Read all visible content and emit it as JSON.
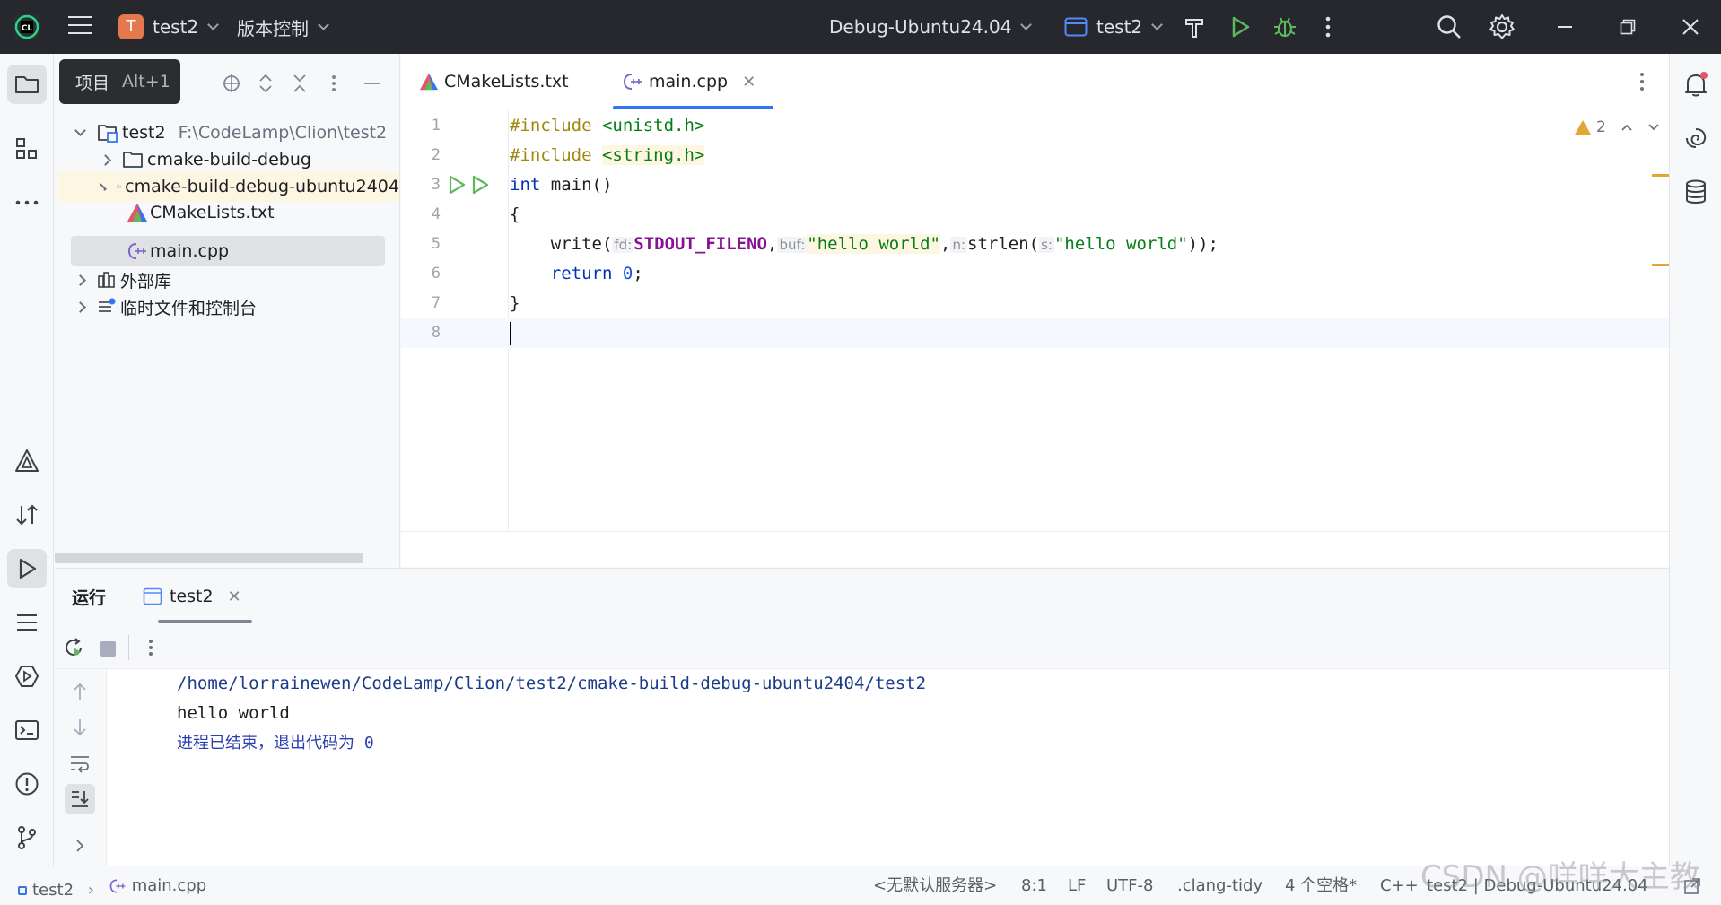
{
  "titlebar": {
    "project_letter": "T",
    "project_name": "test2",
    "vcs_label": "版本控制",
    "run_config": "Debug-Ubuntu24.04",
    "target": "test2"
  },
  "tooltip": {
    "label": "项目",
    "shortcut": "Alt+1"
  },
  "project_tree": {
    "root_name": "test2",
    "root_path": "F:\\CodeLamp\\Clion\\test2",
    "items": [
      {
        "label": "cmake-build-debug"
      },
      {
        "label": "cmake-build-debug-ubuntu2404"
      },
      {
        "label": "CMakeLists.txt"
      },
      {
        "label": "main.cpp"
      }
    ],
    "external_libs": "外部库",
    "scratches": "临时文件和控制台"
  },
  "editor": {
    "tabs": [
      {
        "label": "CMakeLists.txt"
      },
      {
        "label": "main.cpp"
      }
    ],
    "warning_count": "2",
    "line_numbers": [
      "1",
      "2",
      "3",
      "4",
      "5",
      "6",
      "7",
      "8"
    ],
    "code": {
      "l1_directive": "#include",
      "l1_header": "<unistd.h>",
      "l2_directive": "#include",
      "l2_header": "<string.h>",
      "l3_type": "int",
      "l3_rest": " main()",
      "l4": "{",
      "l5_call": "write(",
      "l5_hint_fd": "fd:",
      "l5_arg1": "STDOUT_FILENO",
      "l5_comma1": ",",
      "l5_hint_buf": "buf:",
      "l5_arg2": "\"hello world\"",
      "l5_comma2": ",",
      "l5_hint_n": "n:",
      "l5_call2": "strlen(",
      "l5_hint_s": "s:",
      "l5_arg3": "\"hello world\"",
      "l5_end": "));",
      "l6_kw": "return",
      "l6_num": "0",
      "l6_end": ";",
      "l7": "}"
    }
  },
  "run_panel": {
    "title": "运行",
    "tab_label": "test2",
    "console_lines": [
      "/home/lorrainewen/CodeLamp/Clion/test2/cmake-build-debug-ubuntu2404/test2",
      "hello world",
      "进程已结束，退出代码为 0"
    ]
  },
  "statusbar": {
    "crumb_project": "test2",
    "crumb_file": "main.cpp",
    "server": "<无默认服务器>",
    "position": "8:1",
    "line_sep": "LF",
    "encoding": "UTF-8",
    "inspector": ".clang-tidy",
    "indent": "4 个空格*",
    "language": "C++",
    "context": "test2 | Debug-Ubuntu24.04"
  },
  "watermark": "CSDN @咩咩大主教",
  "colors": {
    "titlebar_bg": "#27282e",
    "accent": "#3574f0",
    "run_green": "#5fb85c",
    "warning": "#e2a633",
    "project_badge": "#e5794d"
  }
}
